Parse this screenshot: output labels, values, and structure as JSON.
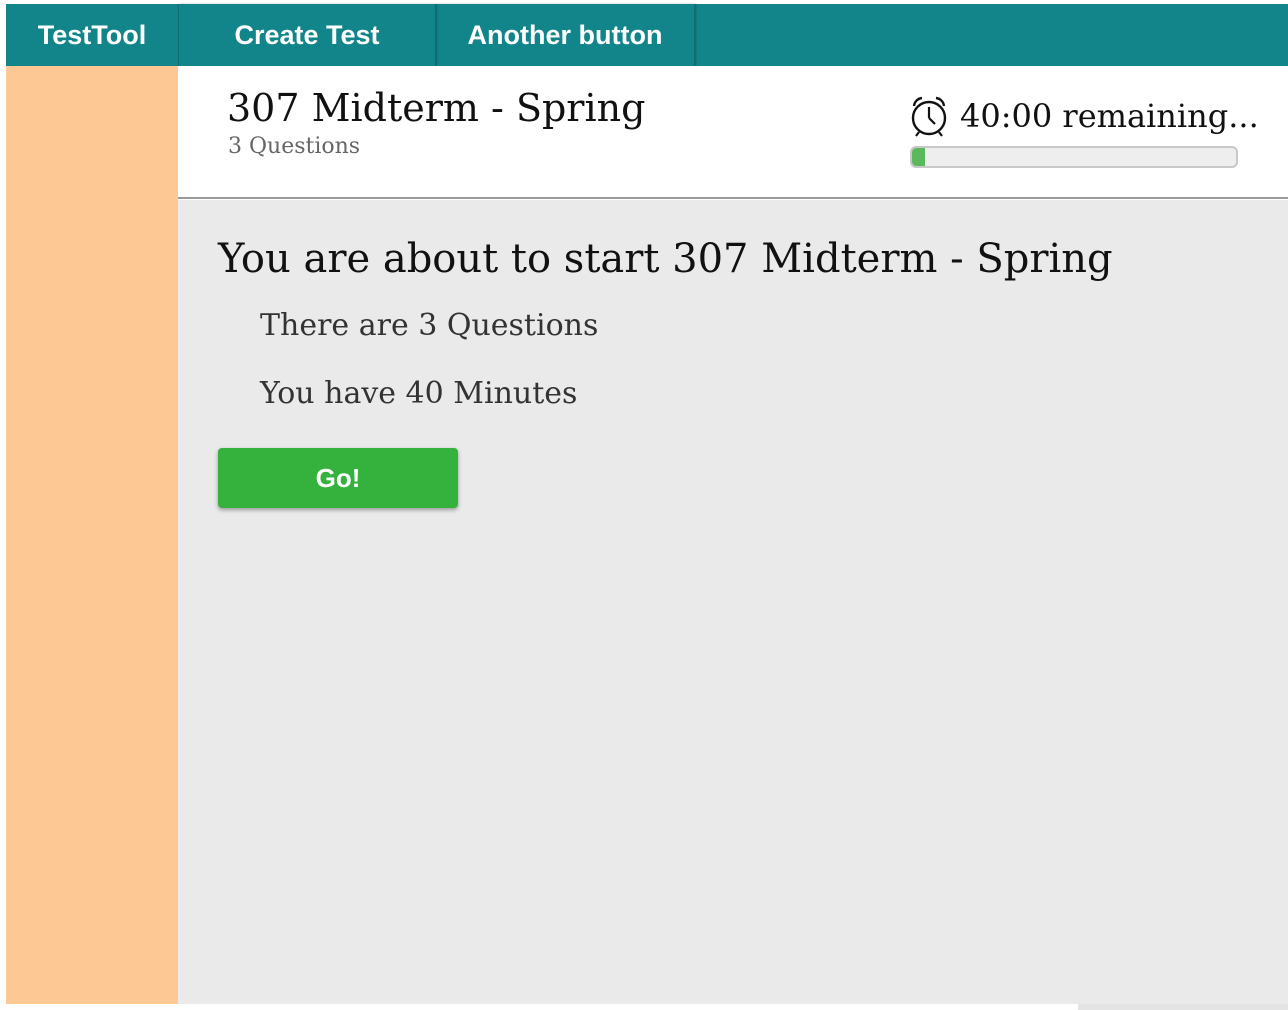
{
  "nav": {
    "brand": "TestTool",
    "create_test": "Create Test",
    "another_button": "Another button"
  },
  "header": {
    "title": "307 Midterm - Spring",
    "subtitle": "3 Questions",
    "timer_text": "40:00 remaining...",
    "timer_icon": "alarm-clock-icon",
    "progress_fraction": 0.04
  },
  "main": {
    "heading": "You are about to start 307 Midterm - Spring",
    "questions_line": "There are 3 Questions",
    "time_line": "You have 40 Minutes",
    "go_label": "Go!"
  },
  "colors": {
    "nav_bg": "#12858a",
    "sidebar_bg": "#fec895",
    "main_bg": "#eaeaea",
    "go_button": "#35b23e",
    "progress_fill": "#5cb85c"
  }
}
